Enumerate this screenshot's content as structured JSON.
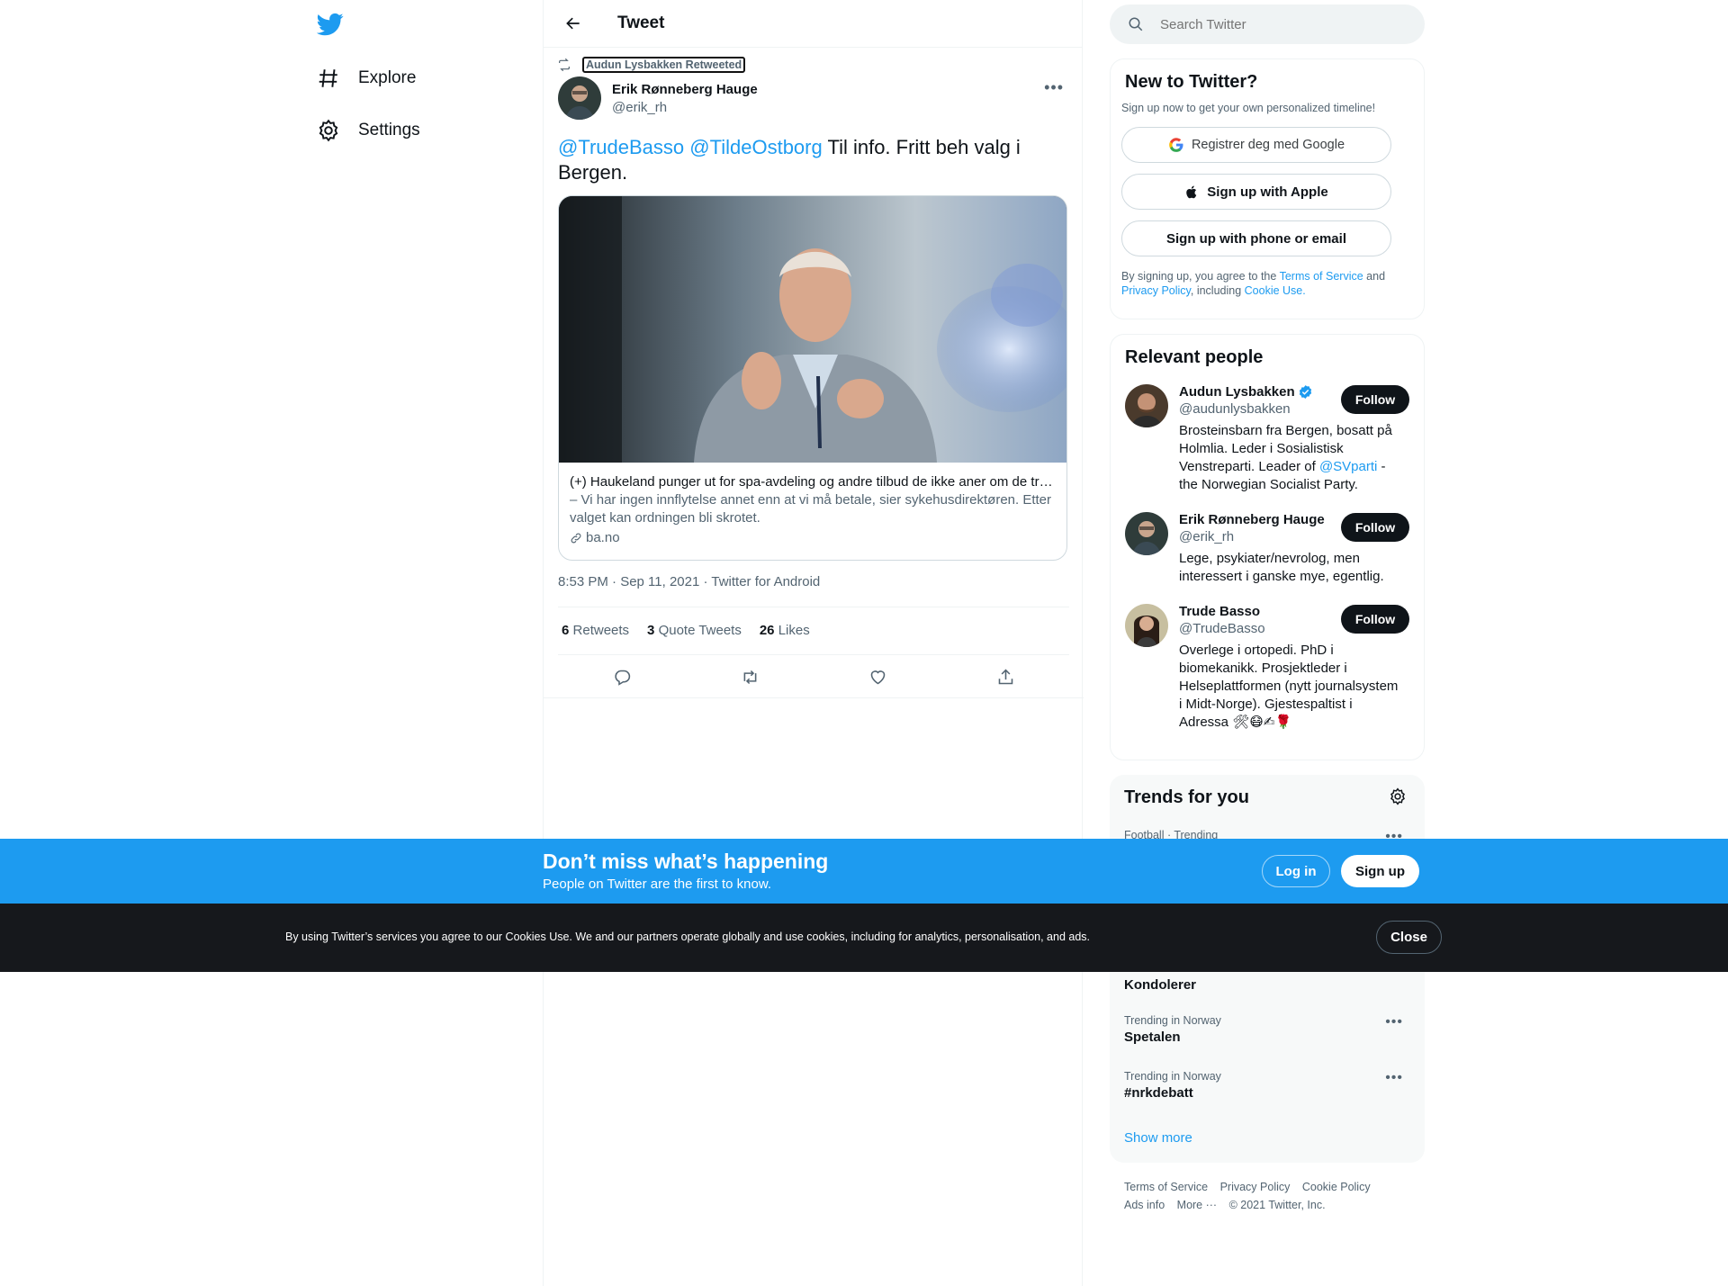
{
  "nav": {
    "explore_label": "Explore",
    "settings_label": "Settings"
  },
  "header": {
    "title": "Tweet"
  },
  "tweet": {
    "retweeted_by": "Audun Lysbakken Retweeted",
    "author_name": "Erik Rønneberg Hauge",
    "author_handle": "@erik_rh",
    "mention1": "@TrudeBasso",
    "mention2": "@TildeOstborg",
    "text": " Til info. Fritt beh valg i Bergen.",
    "card": {
      "title": "(+) Haukeland punger ut for spa-avdeling og andre tilbud de ikke aner om de trenger",
      "description": "– Vi har ingen innflytelse annet enn at vi må betale, sier sykehusdirektøren. Etter valget kan ordningen bli skrotet.",
      "domain": "ba.no"
    },
    "timestamp": "8:53 PM · Sep 11, 2021 · Twitter for Android",
    "stats": {
      "retweets_count": "6",
      "retweets_label": "Retweets",
      "quotes_count": "3",
      "quotes_label": "Quote Tweets",
      "likes_count": "26",
      "likes_label": "Likes"
    }
  },
  "search": {
    "placeholder": "Search Twitter"
  },
  "new_to_twitter": {
    "title": "New to Twitter?",
    "subtitle": "Sign up now to get your own personalized timeline!",
    "google_label": "Registrer deg med Google",
    "apple_label": "Sign up with Apple",
    "phone_label": "Sign up with phone or email",
    "terms_prefix": "By signing up, you agree to the ",
    "terms_link": "Terms of Service",
    "terms_and": " and ",
    "privacy_link": "Privacy Policy",
    "including": ", including ",
    "cookie_link": "Cookie Use."
  },
  "relevant_people": {
    "title": "Relevant people",
    "follow_label": "Follow",
    "people": [
      {
        "name": "Audun Lysbakken",
        "handle": "@audunlysbakken",
        "bio_pre": "Brosteinsbarn fra Bergen, bosatt på Holmlia. Leder i Sosialistisk Venstreparti. Leader of ",
        "bio_link": "@SVparti",
        "bio_post": " - the Norwegian Socialist Party."
      },
      {
        "name": "Erik Rønneberg Hauge",
        "handle": "@erik_rh",
        "bio": "Lege, psykiater/nevrolog, men interessert i ganske mye, egentlig."
      },
      {
        "name": "Trude Basso",
        "handle": "@TrudeBasso",
        "bio": "Overlege i ortopedi. PhD i biomekanikk. Prosjektleder i Helseplattformen (nytt journalsystem i Midt-Norge). Gjestespaltist i Adressa 🛠😷✍🌹"
      }
    ]
  },
  "trends": {
    "title": "Trends for you",
    "items": [
      {
        "context": "Football · Trending",
        "name": ""
      },
      {
        "context": "",
        "name": "Kondolerer"
      },
      {
        "context": "Trending in Norway",
        "name": "Spetalen"
      },
      {
        "context": "Trending in Norway",
        "name": "#nrkdebatt"
      }
    ],
    "show_more": "Show more"
  },
  "footer": {
    "terms": "Terms of Service",
    "privacy": "Privacy Policy",
    "cookie": "Cookie Policy",
    "ads": "Ads info",
    "more": "More ···",
    "copyright": "© 2021 Twitter, Inc."
  },
  "banner": {
    "title": "Don’t miss what’s happening",
    "subtitle": "People on Twitter are the first to know.",
    "login_label": "Log in",
    "signup_label": "Sign up"
  },
  "cookie_bar": {
    "text": "By using Twitter’s services you agree to our Cookies Use. We and our partners operate globally and use cookies, including for analytics, personalisation, and ads.",
    "close_label": "Close"
  },
  "colors": {
    "accent": "#1d9bf0",
    "text": "#0f1419",
    "secondary": "#536471",
    "cookie_bg": "#16181c"
  }
}
